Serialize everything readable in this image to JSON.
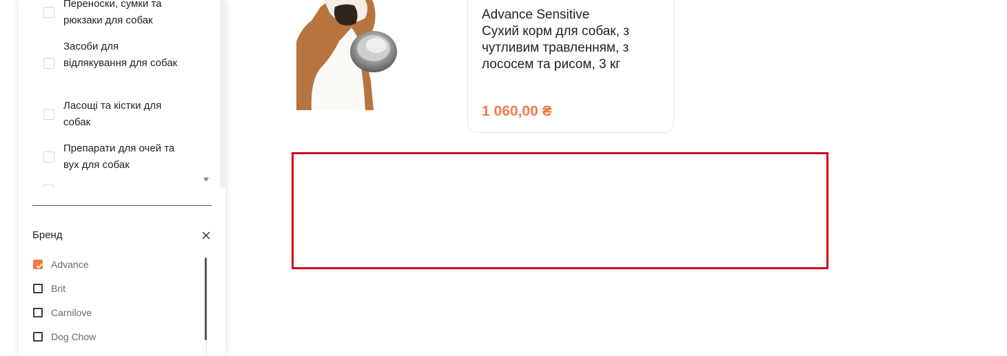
{
  "categories": [
    {
      "label": "Переноски, сумки та рюкзаки для собак"
    },
    {
      "label": "Засоби для відлякування для собак"
    },
    {
      "label": "Ласощі та кістки для собак"
    },
    {
      "label": "Препарати для очей та вух для собак"
    }
  ],
  "brand_filter": {
    "title": "Бренд",
    "items": [
      {
        "label": "Advance",
        "checked": true
      },
      {
        "label": "Brit",
        "checked": false
      },
      {
        "label": "Carnilove",
        "checked": false
      },
      {
        "label": "Dog Chow",
        "checked": false
      }
    ]
  },
  "product": {
    "brand": "Advance Sensitive",
    "description": "Сухий корм для собак, з чутливим травленням, з лососем та рисом, 3 кг",
    "price": "1 060,00 ₴"
  },
  "colors": {
    "accent": "#f47a45",
    "highlight_border": "#d0021b"
  }
}
